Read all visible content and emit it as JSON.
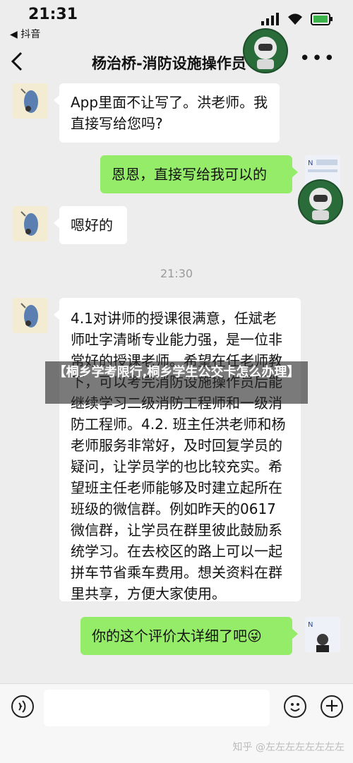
{
  "status_bar": {
    "time": "21:31",
    "back_app": "◀ 抖音"
  },
  "nav": {
    "title": "杨治桥-消防设施操作员"
  },
  "messages": {
    "m1": "App里面不让写了。洪老师。我直接写给您吗?",
    "m2": "恩恩，直接写给我可以的",
    "m3": "嗯好的",
    "timestamp": "21:30",
    "m4": "4.1对讲师的授课很满意，任斌老师吐字清晰专业能力强，是一位非常好的授课老师。希望在任老师教下，可以考完消防设施操作员后能继续学习二级消防工程师和一级消防工程师。4.2. 班主任洪老师和杨老师服务非常好，及时回复学员的疑问，让学员学的也比较充实。希望班主任老师能够及时建立起所在班级的微信群。例如昨天的0617微信群，让学员在群里彼此鼓励系统学习。在去校区的路上可以一起拼车节省乘车费用。想关资料在群里共享，方便大家使用。",
    "m5": "你的这个评价太详细了吧😜"
  },
  "overlay": {
    "text": "【桐乡学考限行,桐乡学生公交卡怎么办理】"
  },
  "watermark": "知乎 @左左左左左左左左",
  "colors": {
    "green_bubble": "#95ec69",
    "background": "#ededed"
  }
}
